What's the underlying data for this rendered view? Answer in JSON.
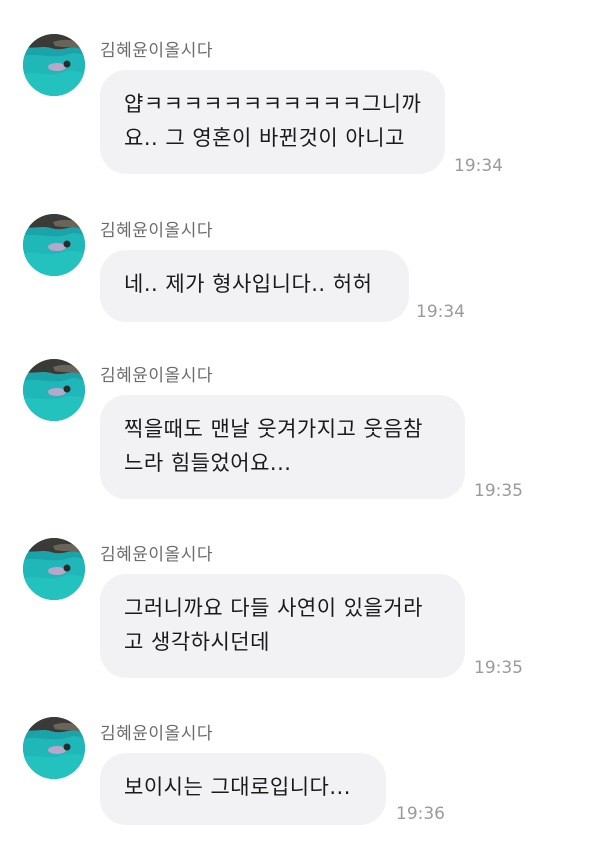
{
  "chat": {
    "messages": [
      {
        "sender": "김혜윤이올시다",
        "lines": [
          "얍ㅋㅋㅋㅋㅋㅋㅋㅋㅋㅋㅋ그니까",
          "요.. 그 영혼이 바뀐것이 아니고"
        ],
        "time": "19:34"
      },
      {
        "sender": "김혜윤이올시다",
        "lines": [
          "네.. 제가 형사입니다.. 허허"
        ],
        "time": "19:34"
      },
      {
        "sender": "김혜윤이올시다",
        "lines": [
          "찍을때도 맨날 웃겨가지고 웃음참",
          "느라 힘들었어요..."
        ],
        "time": "19:35"
      },
      {
        "sender": "김혜윤이올시다",
        "lines": [
          "그러니까요 다들 사연이 있을거라",
          "고 생각하시던데"
        ],
        "time": "19:35"
      },
      {
        "sender": "김혜윤이올시다",
        "lines": [
          "보이시는 그대로입니다..."
        ],
        "time": "19:36"
      }
    ]
  },
  "colors": {
    "bubble_bg": "#f2f2f4",
    "text": "#1a1a1a",
    "sender": "#6b6b6b",
    "time": "#9a9a9a"
  }
}
